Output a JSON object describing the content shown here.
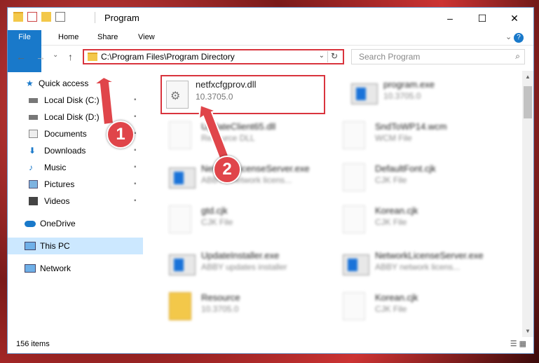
{
  "window": {
    "title": "Program",
    "controls": {
      "minimize": "–",
      "maximize": "☐",
      "close": "✕"
    }
  },
  "ribbon": {
    "tabs": [
      "File",
      "Home",
      "Share",
      "View"
    ],
    "expand": "⌄",
    "help": "?"
  },
  "address_bar": {
    "path": "C:\\Program Files\\Program Directory",
    "dropdown": "⌄",
    "refresh": "↻"
  },
  "search": {
    "placeholder": "Search Program",
    "icon": "⌕"
  },
  "nav_buttons": {
    "back": "←",
    "forward": "→",
    "history": "⌄",
    "up": "↑"
  },
  "sidebar": {
    "items": [
      {
        "label": "Quick access",
        "icon": "star-icon",
        "pinned": false
      },
      {
        "label": "Local Disk (C:)",
        "icon": "drive-icon",
        "pinned": true
      },
      {
        "label": "Local Disk (D:)",
        "icon": "drive-icon",
        "pinned": true
      },
      {
        "label": "Documents",
        "icon": "documents-icon",
        "pinned": true
      },
      {
        "label": "Downloads",
        "icon": "downloads-icon",
        "pinned": true
      },
      {
        "label": "Music",
        "icon": "music-icon",
        "pinned": true
      },
      {
        "label": "Pictures",
        "icon": "pictures-icon",
        "pinned": true
      },
      {
        "label": "Videos",
        "icon": "videos-icon",
        "pinned": true
      },
      {
        "label": "OneDrive",
        "icon": "cloud-icon",
        "pinned": false
      },
      {
        "label": "This PC",
        "icon": "pc-icon",
        "pinned": false,
        "selected": true
      },
      {
        "label": "Network",
        "icon": "network-icon",
        "pinned": false
      }
    ],
    "pin_glyph": "📌"
  },
  "files": {
    "highlighted": {
      "name": "netfxcfgprov.dll",
      "version": "10.3705.0"
    },
    "others": [
      {
        "name": "program.exe",
        "sub": "10.3705.0",
        "icon": "exe"
      },
      {
        "name": "UpdateClient65.dll",
        "sub": "Resource DLL",
        "icon": "doc"
      },
      {
        "name": "SndToWP14.wcm",
        "sub": "WCM File",
        "icon": "doc"
      },
      {
        "name": "NetworkLicenseServer.exe",
        "sub": "ABBYY network licens...",
        "icon": "exe"
      },
      {
        "name": "DefaultFont.cjk",
        "sub": "CJK File",
        "icon": "doc"
      },
      {
        "name": "gtd.cjk",
        "sub": "CJK File",
        "icon": "doc"
      },
      {
        "name": "Korean.cjk",
        "sub": "CJK File",
        "icon": "doc"
      },
      {
        "name": "UpdateInstaller.exe",
        "sub": "ABBY updates installer",
        "icon": "exe"
      },
      {
        "name": "NetworkLicenseServer.exe",
        "sub": "ABBY network licens...",
        "icon": "exe"
      },
      {
        "name": "Resource",
        "sub": "10.3705.0",
        "icon": "folder"
      },
      {
        "name": "Korean.cjk",
        "sub": "CJK File",
        "icon": "doc"
      }
    ]
  },
  "status": {
    "item_count": "156 items"
  },
  "callouts": {
    "one": "1",
    "two": "2"
  },
  "colors": {
    "highlight_border": "#d9343d",
    "callout_fill": "#e0454a",
    "file_tab": "#1979ca",
    "selected_nav": "#cce8ff"
  }
}
